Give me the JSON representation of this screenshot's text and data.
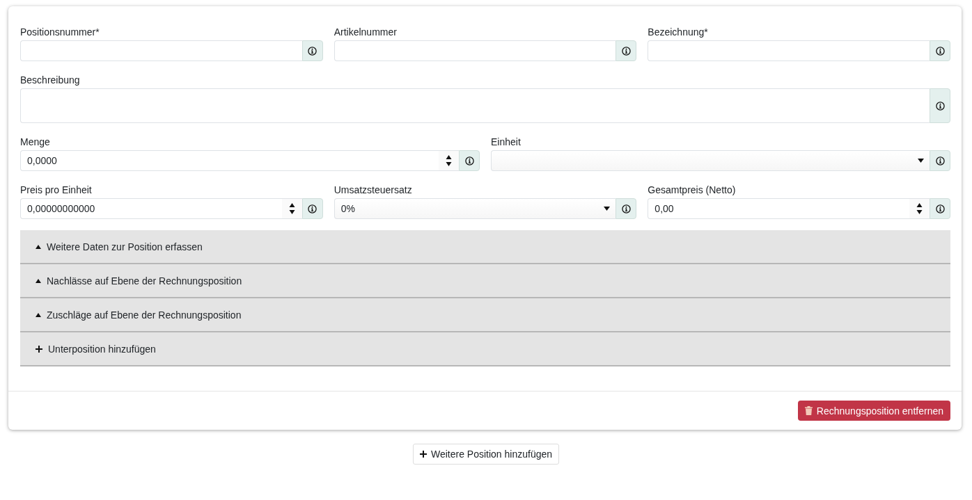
{
  "rows": [
    {
      "fields": [
        {
          "label": "Positionsnummer*",
          "kind": "text"
        },
        {
          "label": "Artikelnummer",
          "kind": "text"
        },
        {
          "label": "Bezeichnung*",
          "kind": "text"
        }
      ]
    },
    {
      "fields": [
        {
          "label": "Beschreibung",
          "kind": "textarea"
        }
      ]
    },
    {
      "fields": [
        {
          "label": "Menge",
          "kind": "number",
          "value": "0,0000"
        },
        {
          "label": "Einheit",
          "kind": "select"
        }
      ]
    },
    {
      "fields": [
        {
          "label": "Preis pro Einheit",
          "kind": "number",
          "value": "0,00000000000"
        },
        {
          "label": "Umsatzsteuersatz",
          "kind": "select",
          "value": "0%"
        },
        {
          "label": "Gesamtpreis (Netto)",
          "kind": "number",
          "value": "0,00"
        }
      ]
    }
  ],
  "sections": [
    {
      "label": "Weitere Daten zur Position erfassen",
      "kind": "toggle"
    },
    {
      "label": "Nachlässe auf Ebene der Rechnungsposition",
      "kind": "toggle"
    },
    {
      "label": "Zuschläge auf Ebene der Rechnungsposition",
      "kind": "toggle"
    },
    {
      "label": "Unterposition hinzufügen",
      "kind": "add"
    }
  ],
  "remove_button": "Rechnungsposition entfernen",
  "add_button": "Weitere Position hinzufügen"
}
